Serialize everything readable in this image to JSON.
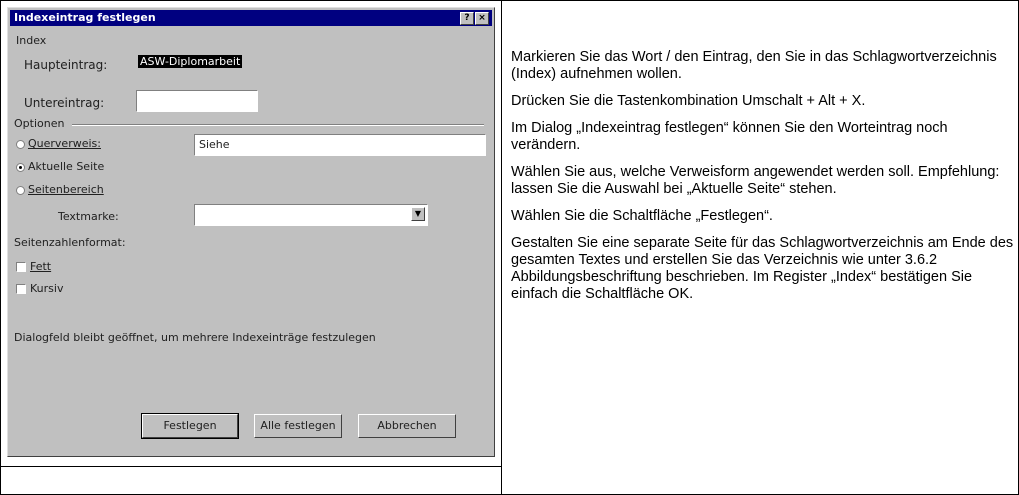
{
  "dialog": {
    "title": "Indexeintrag festlegen",
    "title_buttons": [
      "?",
      "×"
    ],
    "index_group": "Index",
    "haupteintrag_label": "Haupteintrag:",
    "haupteintrag_value": "ASW-Diplomarbeit",
    "untereintrag_label": "Untereintrag:",
    "untereintrag_value": "",
    "optionen_group": "Optionen",
    "option_querverweis": "Querverweis:",
    "querverweis_value": "Siehe",
    "option_aktuelle_seite": "Aktuelle Seite",
    "option_seitenbereich": "Seitenbereich",
    "textmarke_label": "Textmarke:",
    "textmarke_value": "",
    "seitenzahlenformat_label": "Seitenzahlenformat:",
    "fett_label": "Fett",
    "kursiv_label": "Kursiv",
    "hint": "Dialogfeld bleibt geöffnet, um mehrere Indexeinträge festzulegen",
    "festlegen_button": "Festlegen",
    "alle_festlegen_button": "Alle festlegen",
    "abbrechen_button": "Abbrechen"
  },
  "instructions": [
    "Markieren Sie das Wort / den Eintrag, den Sie in das Schlagwortverzeichnis (Index) aufnehmen wollen.",
    "Drücken Sie die Tastenkombination Umschalt + Alt + X.",
    "Im Dialog „Indexeintrag festlegen“ können Sie den Worteintrag noch verändern.",
    "Wählen Sie aus, welche Verweisform angewendet werden soll. Empfehlung: lassen Sie die Auswahl bei „Aktuelle Seite“ stehen.",
    "Wählen Sie die Schaltfläche „Festlegen“.",
    "Gestalten Sie eine separate Seite für das Schlagwortverzeichnis am Ende des gesamten Textes und erstellen Sie das Verzeichnis wie unter 3.6.2 Abbildungsbeschriftung beschrieben. Im Register „Index“ bestätigen Sie einfach die Schaltfläche OK."
  ]
}
